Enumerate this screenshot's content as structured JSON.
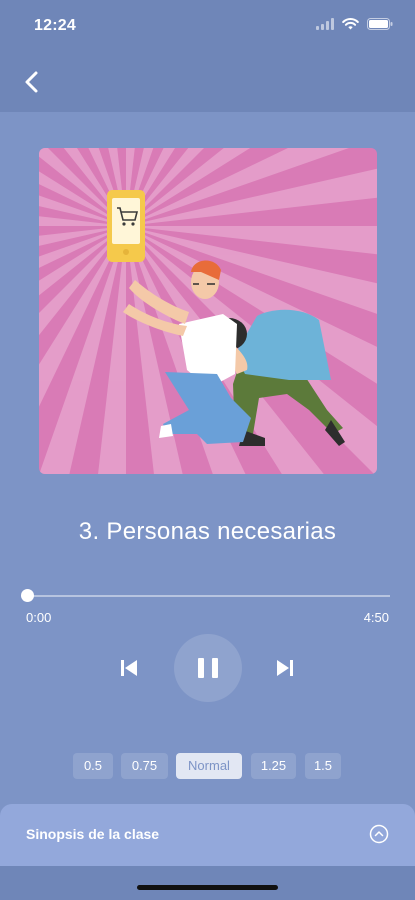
{
  "status_bar": {
    "time": "12:24"
  },
  "nav": {
    "back_icon": "chevron-left-icon"
  },
  "episode": {
    "title": "3. Personas necesarias"
  },
  "player": {
    "elapsed": "0:00",
    "total": "4:50",
    "progress": 0.0,
    "state": "playing",
    "icons": {
      "previous": "skip-back-icon",
      "pause": "pause-icon",
      "next": "skip-forward-icon"
    }
  },
  "speeds": {
    "options": [
      "0.5",
      "0.75",
      "Normal",
      "1.25",
      "1.5"
    ],
    "selected": "Normal"
  },
  "synopsis": {
    "label": "Sinopsis de la clase",
    "icon": "chevron-up-circle-icon"
  },
  "colors": {
    "background": "#7d94c6",
    "header": "#6f86b8",
    "panel": "#93a8db",
    "artwork_background": "#d97bb6",
    "phone": "#f5c94b"
  }
}
